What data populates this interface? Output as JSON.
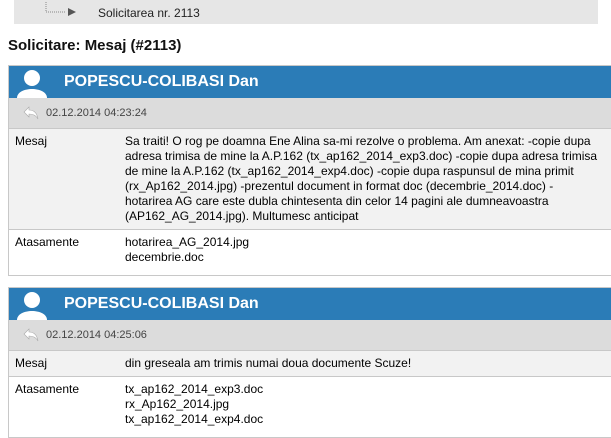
{
  "breadcrumb": {
    "label": "Solicitarea nr. 2113"
  },
  "page_title": "Solicitare: Mesaj (#2113)",
  "labels": {
    "message": "Mesaj",
    "attachments": "Atasamente"
  },
  "messages": [
    {
      "author": "POPESCU-COLIBASI Dan",
      "date": "02.12.2014 04:23:24",
      "text": "Sa traiti! O rog pe doamna Ene Alina sa-mi rezolve o problema. Am anexat: -copie dupa adresa trimisa de mine la A.P.162 (tx_ap162_2014_exp3.doc) -copie dupa adresa trimisa de mine la A.P.162 (tx_ap162_2014_exp4.doc) -copie dupa raspunsul de mina primit (rx_Ap162_2014.jpg) -prezentul document in format doc (decembrie_2014.doc) -hotarirea AG care este dubla chintesenta din celor 14 pagini ale dumneavoastra (AP162_AG_2014.jpg). Multumesc anticipat",
      "attachments": [
        "hotarirea_AG_2014.jpg",
        "decembrie.doc"
      ]
    },
    {
      "author": "POPESCU-COLIBASI Dan",
      "date": "02.12.2014 04:25:06",
      "text": "din greseala am trimis numai doua documente Scuze!",
      "attachments": [
        "tx_ap162_2014_exp3.doc",
        "rx_Ap162_2014.jpg",
        "tx_ap162_2014_exp4.doc"
      ]
    }
  ],
  "colors": {
    "header": "#2b7cb7",
    "subheader": "#dcdcdc",
    "breadcrumb_bg": "#e6e6e6"
  },
  "icons": {
    "avatar": "user-silhouette-icon",
    "reply": "reply-arrow-icon",
    "breadcrumb": "tree-branch-arrow-icon"
  }
}
